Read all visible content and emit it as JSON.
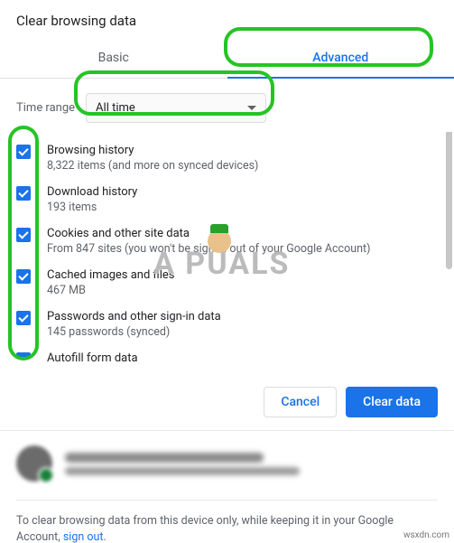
{
  "title": "Clear browsing data",
  "tabs": {
    "basic": "Basic",
    "advanced": "Advanced"
  },
  "time": {
    "label": "Time range",
    "value": "All time"
  },
  "items": [
    {
      "title": "Browsing history",
      "desc": "8,322 items (and more on synced devices)"
    },
    {
      "title": "Download history",
      "desc": "193 items"
    },
    {
      "title": "Cookies and other site data",
      "desc": "From 847 sites (you won't be signed out of your Google Account)"
    },
    {
      "title": "Cached images and files",
      "desc": "467 MB"
    },
    {
      "title": "Passwords and other sign-in data",
      "desc": "145 passwords (synced)"
    },
    {
      "title": "Autofill form data",
      "desc": ""
    }
  ],
  "buttons": {
    "cancel": "Cancel",
    "clear": "Clear data"
  },
  "footer": {
    "text": "To clear browsing data from this device only, while keeping it in your Google Account, ",
    "link": "sign out"
  },
  "watermark_site": "wsxdn.com",
  "watermark_brand": "A    PUALS"
}
